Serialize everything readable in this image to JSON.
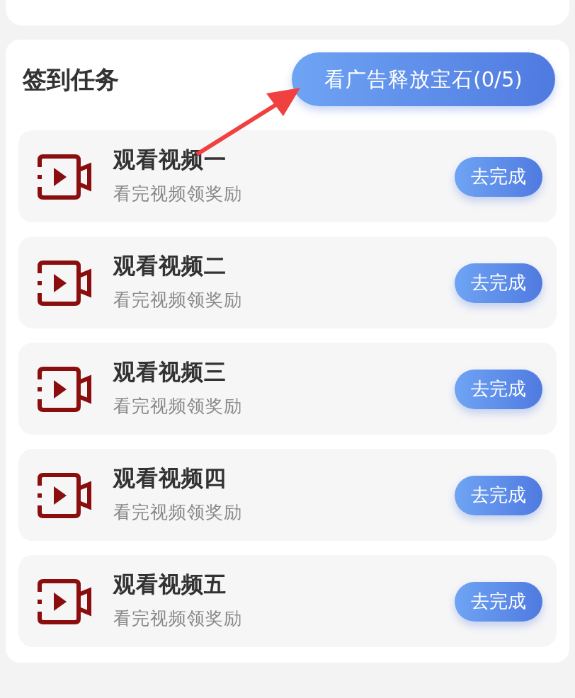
{
  "section": {
    "title": "签到任务",
    "ad_button": "看广告释放宝石(0/5)"
  },
  "tasks": [
    {
      "title": "观看视频一",
      "subtitle": "看完视频领奖励",
      "action": "去完成"
    },
    {
      "title": "观看视频二",
      "subtitle": "看完视频领奖励",
      "action": "去完成"
    },
    {
      "title": "观看视频三",
      "subtitle": "看完视频领奖励",
      "action": "去完成"
    },
    {
      "title": "观看视频四",
      "subtitle": "看完视频领奖励",
      "action": "去完成"
    },
    {
      "title": "观看视频五",
      "subtitle": "看完视频领奖励",
      "action": "去完成"
    }
  ]
}
